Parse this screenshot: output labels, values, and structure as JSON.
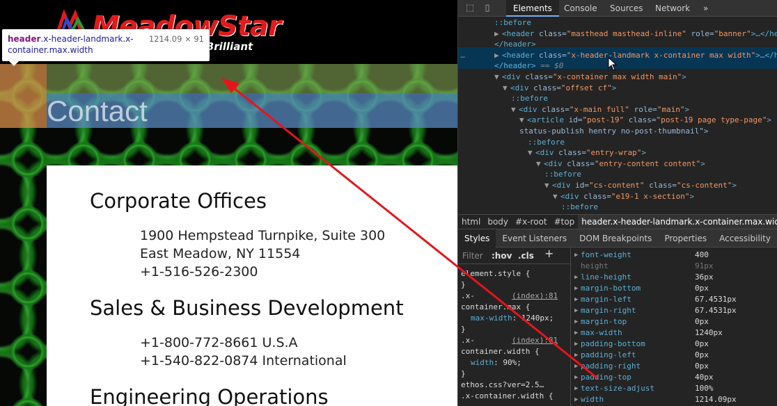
{
  "site": {
    "logo_text": "MeadowStar",
    "logo_tagline": "ght Brilliant",
    "page_title": "Contact",
    "tooltip": {
      "element": "header",
      "classes": ".x-header-landmark.x-container.max.width",
      "size": "1214.09 × 91"
    },
    "sections": [
      {
        "heading": "Corporate Offices",
        "lines": [
          "1900 Hempstead Turnpike, Suite 300",
          "East Meadow, NY 11554",
          "+1-516-526-2300"
        ]
      },
      {
        "heading": "Sales & Business Development",
        "lines": [
          "+1-800-772-8661 U.S.A",
          "+1-540-822-0874 International"
        ]
      },
      {
        "heading": "Engineering Operations",
        "lines": []
      }
    ]
  },
  "devtools": {
    "tabs": [
      "Elements",
      "Console",
      "Sources",
      "Network"
    ],
    "more_tabs": "»",
    "tree": [
      {
        "indent": 0,
        "text_pseudo": "::before"
      },
      {
        "indent": 0,
        "tri": "▶",
        "tag": "header",
        "attrs": [
          [
            "class",
            "masthead masthead-inline"
          ],
          [
            "role",
            "banner"
          ]
        ],
        "suffix": "…"
      },
      {
        "indent": 0,
        "close": "</header>"
      },
      {
        "indent": 0,
        "tri": "▶",
        "tag": "header",
        "attrs": [
          [
            "class",
            "x-header-landmark x-container max width"
          ]
        ],
        "suffix": "…",
        "selected": true
      },
      {
        "indent": 0,
        "close": "</header>",
        "eq": "== $0"
      },
      {
        "indent": 0,
        "tri": "▼",
        "tag": "div",
        "attrs": [
          [
            "class",
            "x-container max width main"
          ]
        ]
      },
      {
        "indent": 1,
        "tri": "▼",
        "tag": "div",
        "attrs": [
          [
            "class",
            "offset cf"
          ]
        ]
      },
      {
        "indent": 2,
        "text_pseudo": "::before"
      },
      {
        "indent": 2,
        "tri": "▼",
        "tag": "div",
        "attrs": [
          [
            "class",
            "x-main full"
          ],
          [
            "role",
            "main"
          ]
        ]
      },
      {
        "indent": 3,
        "tri": "▼",
        "tag": "article",
        "attrs": [
          [
            "id",
            "post-19"
          ],
          [
            "class",
            "post-19 page type-page"
          ]
        ]
      },
      {
        "indent": 3,
        "cont": "status-publish hentry no-post-thumbnail\">"
      },
      {
        "indent": 4,
        "text_pseudo": "::before"
      },
      {
        "indent": 4,
        "tri": "▼",
        "tag": "div",
        "attrs": [
          [
            "class",
            "entry-wrap"
          ]
        ]
      },
      {
        "indent": 5,
        "tri": "▼",
        "tag": "div",
        "attrs": [
          [
            "class",
            "entry-content content"
          ]
        ]
      },
      {
        "indent": 6,
        "text_pseudo": "::before"
      },
      {
        "indent": 6,
        "tri": "▼",
        "tag": "div",
        "attrs": [
          [
            "id",
            "cs-content"
          ],
          [
            "class",
            "cs-content"
          ]
        ]
      },
      {
        "indent": 7,
        "tri": "▼",
        "tag": "div",
        "attrs": [
          [
            "class",
            "e19-1 x-section"
          ]
        ]
      },
      {
        "indent": 8,
        "text_pseudo": "::before"
      }
    ],
    "breadcrumbs": [
      "html",
      "body",
      "#x-root",
      "#top",
      "header.x-header-landmark.x-container.max.width"
    ],
    "styles_tabs": [
      "Styles",
      "Event Listeners",
      "DOM Breakpoints",
      "Properties",
      "Accessibility"
    ],
    "filter": {
      "placeholder": "Filter",
      "hov": ":hov",
      "cls": ".cls",
      "plus": "+"
    },
    "rules": [
      {
        "selector": "element.style {",
        "source": ""
      },
      {
        "selector": "}",
        "source": ""
      },
      {
        "selector": ".x-",
        "source": "(index):81"
      },
      {
        "selector": "container.max {",
        "source": ""
      },
      {
        "prop": "max-width",
        "value": "1240px;"
      },
      {
        "selector": "}",
        "source": ""
      },
      {
        "selector": ".x-",
        "source": "(index):81"
      },
      {
        "selector": "container.width {",
        "source": ""
      },
      {
        "prop": "width",
        "value": "90%;"
      },
      {
        "selector": "}",
        "source": ""
      },
      {
        "selector": "ethos.css?ver=2.5…",
        "source": ""
      },
      {
        "selector": ".x-container.width {",
        "source": ""
      }
    ],
    "computed": [
      {
        "name": "font-weight",
        "value": "400"
      },
      {
        "name": "height",
        "value": "91px",
        "inactive": true
      },
      {
        "name": "line-height",
        "value": "36px"
      },
      {
        "name": "margin-bottom",
        "value": "0px"
      },
      {
        "name": "margin-left",
        "value": "67.4531px"
      },
      {
        "name": "margin-right",
        "value": "67.4531px"
      },
      {
        "name": "margin-top",
        "value": "0px"
      },
      {
        "name": "max-width",
        "value": "1240px"
      },
      {
        "name": "padding-bottom",
        "value": "0px"
      },
      {
        "name": "padding-left",
        "value": "0px"
      },
      {
        "name": "padding-right",
        "value": "0px"
      },
      {
        "name": "padding-top",
        "value": "40px"
      },
      {
        "name": "text-size-adjust",
        "value": "100%"
      },
      {
        "name": "width",
        "value": "1214.09px"
      }
    ]
  },
  "colors": {
    "annotation_arrow": "#e8141b",
    "logo_red": "#e01b1b",
    "devtools_bg": "#242424",
    "selected_node": "#073655"
  }
}
